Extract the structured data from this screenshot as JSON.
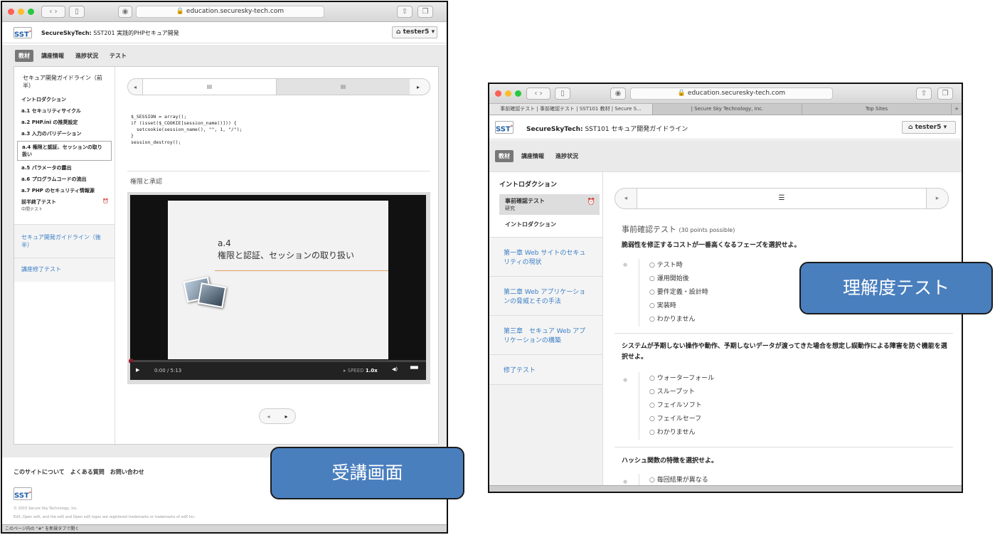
{
  "w1": {
    "url": "education.securesky-tech.com",
    "site_prefix": "SecureSkyTech:",
    "course": "SST201 実践的PHPセキュア開発",
    "user": "tester5",
    "nav": [
      "教材",
      "講座情報",
      "進捗状況",
      "テスト"
    ],
    "section1": "セキュア開発ガイドライン（前半）",
    "items": [
      "イントロダクション",
      "a.1 セキュリティサイクル",
      "a.2 PHP.ini の推奨設定",
      "a.3 入力のバリデーション",
      "a.4 権限と認証、セッションの取り扱い",
      "a.5 パラメータの露出",
      "a.6 プログラムコードの流出",
      "a.7 PHP のセキュリティ情報源"
    ],
    "midterm": "前半終了テスト",
    "midterm_sub": "中間テスト",
    "section2": "セキュア開発ガイドライン（後半）",
    "section3": "講座修了テスト",
    "code": "$_SESSION = array();\nif (isset($_COOKIE[session_name()])) {\n  setcookie(session_name(), \"\", 1, \"/\");\n}\nsession_destroy();",
    "unit_title": "権限と承認",
    "slide_num": "a.4",
    "slide_title": "権限と認証、セッションの取り扱い",
    "time": "0:00 / 5:13",
    "speed_label": "SPEED",
    "speed": "1.0x",
    "footer_links": "このサイトについて　よくある質問　お問い合わせ",
    "copyright": "© 2015 Secure Sky Technology, Inc.",
    "edx_note": "EdX, Open edX, and the edX and Open edX logos are registered trademarks or trademarks of edX Inc.",
    "status": "このページ内の \"#\" を新規タブで開く"
  },
  "w2": {
    "url": "education.securesky-tech.com",
    "tabs": [
      "事前確認テスト | 事前確認テスト | SST101 教材 | Secure S...",
      "| Secure Sky Technology, Inc.",
      "Top Sites"
    ],
    "site_prefix": "SecureSkyTech:",
    "course": "SST101 セキュア開発ガイドライン",
    "user": "tester5",
    "nav": [
      "教材",
      "講座情報",
      "進捗状況"
    ],
    "section1": "イントロダクション",
    "pretest": "事前確認テスト",
    "pretest_sub": "研究",
    "intro": "イントロダクション",
    "ch1": "第一章 Web サイトのセキュリティの現状",
    "ch2": "第二章 Web アプリケーションの脅威とその手法",
    "ch3": "第三章　セキュア Web アプリケーションの構築",
    "final": "修了テスト",
    "test_title": "事前確認テスト",
    "points": "(30 points possible)",
    "q1": "脆弱性を修正するコストが一番高くなるフェーズを選択せよ。",
    "q1_opts": [
      "テスト時",
      "運用開始後",
      "要件定義・設計時",
      "実装時",
      "わかりません"
    ],
    "q2": "システムが予期しない操作や動作、予期しないデータが渡ってきた場合を想定し誤動作による障害を防ぐ機能を選択せよ。",
    "q2_opts": [
      "ウォーターフォール",
      "スループット",
      "フェイルソフト",
      "フェイルセーフ",
      "わかりません"
    ],
    "q3": "ハッシュ関数の特徴を選択せよ。",
    "q3_opt": "毎回結果が異なる"
  },
  "callout1": "受講画面",
  "callout2": "理解度テスト"
}
